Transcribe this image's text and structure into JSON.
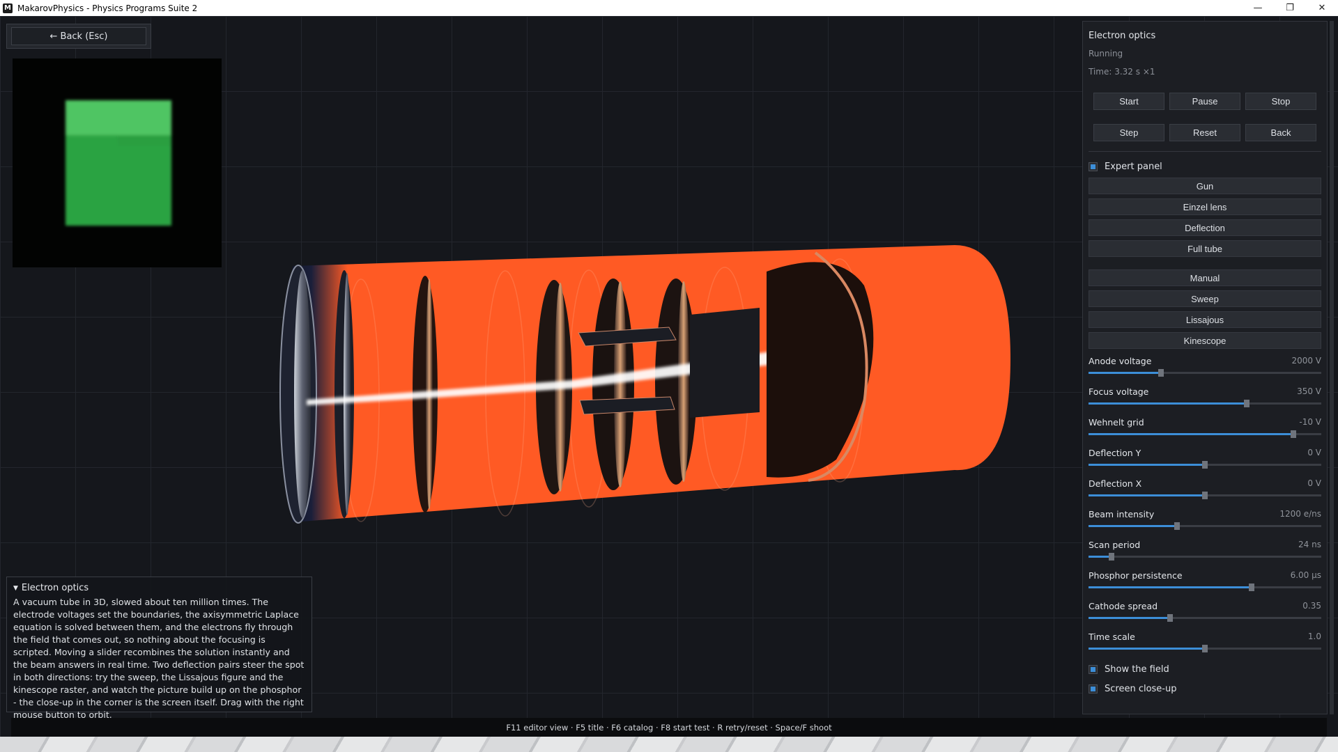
{
  "window": {
    "title": "MakarovPhysics - Physics Programs Suite 2",
    "icon_letter": "M",
    "minimize": "—",
    "restore": "❐",
    "close": "✕"
  },
  "back_button": {
    "label": "← Back (Esc)"
  },
  "info_panel": {
    "title": "Electron optics",
    "text": "A vacuum tube in 3D, slowed about ten million times. The electrode voltages set the boundaries, the axisymmetric Laplace equation is solved between them, and the electrons fly through the field that comes out, so nothing about the focusing is scripted. Moving a slider recombines the solution instantly and the beam answers in real time. Two deflection pairs steer the spot in both directions: try the sweep, the Lissajous figure and the kinescope raster, and watch the picture build up on the phosphor - the close-up in the corner is the screen itself. Drag with the right mouse button to orbit."
  },
  "footer": {
    "hint": "F11 editor view · F5 title · F6 catalog · F8 start test · R retry/reset · Space/F shoot"
  },
  "panel": {
    "title": "Electron optics",
    "status": "Running",
    "time": "Time: 3.32 s   ×1",
    "buttons": [
      "Start",
      "Pause",
      "Stop",
      "Step",
      "Reset",
      "Back"
    ],
    "expert_label": "Expert panel",
    "presets": [
      "Gun",
      "Einzel lens",
      "Deflection",
      "Full tube"
    ],
    "modes": [
      "Manual",
      "Sweep",
      "Lissajous",
      "Kinescope"
    ],
    "sliders": [
      {
        "label": "Anode voltage",
        "value": "2000  V",
        "level": 0.31
      },
      {
        "label": "Focus voltage",
        "value": "350  V",
        "level": 0.68
      },
      {
        "label": "Wehnelt grid",
        "value": "-10  V",
        "level": 0.88
      },
      {
        "label": "Deflection Y",
        "value": "0  V",
        "level": 0.5
      },
      {
        "label": "Deflection X",
        "value": "0  V",
        "level": 0.5
      },
      {
        "label": "Beam intensity",
        "value": "1200  e/ns",
        "level": 0.38
      },
      {
        "label": "Scan period",
        "value": "24  ns",
        "level": 0.1
      },
      {
        "label": "Phosphor persistence",
        "value": "6.00  µs",
        "level": 0.7
      },
      {
        "label": "Cathode spread",
        "value": "0.35",
        "level": 0.35
      },
      {
        "label": "Time scale",
        "value": "1.0",
        "level": 0.5
      }
    ],
    "show_field_label": "Show the field",
    "screen_closeup_label": "Screen close-up"
  },
  "colors": {
    "accent": "#3c8ed8",
    "tube": "#ff5a24",
    "phosphor": "#2fae45"
  }
}
